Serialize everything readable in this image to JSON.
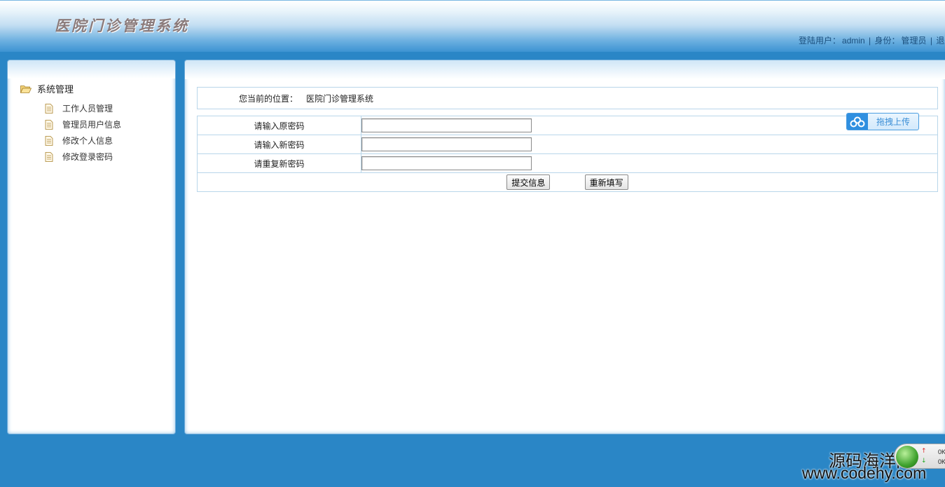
{
  "header": {
    "title": "医院门诊管理系统",
    "user_label": "登陆用户：",
    "username": "admin",
    "separator": "|",
    "role_label": "身份：",
    "role": "管理员",
    "logout_partial": "退"
  },
  "sidebar": {
    "root_label": "系统管理",
    "items": [
      {
        "label": "工作人员管理"
      },
      {
        "label": "管理员用户信息"
      },
      {
        "label": "修改个人信息"
      },
      {
        "label": "修改登录密码"
      }
    ]
  },
  "breadcrumb": {
    "label": "您当前的位置：",
    "value": "医院门诊管理系统"
  },
  "form": {
    "old_password_label": "请输入原密码",
    "old_password_value": "",
    "new_password_label": "请输入新密码",
    "new_password_value": "",
    "confirm_password_label": "请重复新密码",
    "confirm_password_value": "",
    "submit_label": "提交信息",
    "reset_label": "重新填写"
  },
  "upload_widget": {
    "label": "拖拽上传"
  },
  "watermark": {
    "cn": "源码海洋网",
    "url": "www.codehy.com"
  },
  "net_monitor": {
    "upload": "0K",
    "download": "0K"
  },
  "colors": {
    "page_background": "#2a86c6",
    "header_gradient_bottom": "#3c93d2",
    "panel_border": "#6aa9d8",
    "table_border": "#b9d6ea",
    "upload_accent": "#2f8fe0"
  }
}
